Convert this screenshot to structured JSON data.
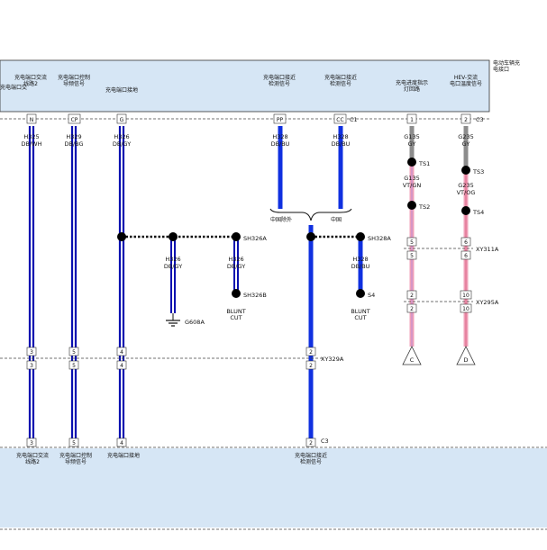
{
  "header": {
    "right_label": "电动车辆充电接口",
    "modules": [
      {
        "id": "m0",
        "label": "充电端口交"
      },
      {
        "id": "m1",
        "label": "充电端口交流线路2"
      },
      {
        "id": "m2",
        "label": "充电端口控制导频信号"
      },
      {
        "id": "m3",
        "label": "充电端口接地"
      },
      {
        "id": "m4",
        "label": "充电端口接近检测信号"
      },
      {
        "id": "m5",
        "label": "充电端口接近检测信号"
      },
      {
        "id": "m6",
        "label": "充电进度指示灯回路"
      },
      {
        "id": "m7",
        "label": "HEV-交流电口温度信号"
      }
    ]
  },
  "top_connector": {
    "c1": "C1",
    "c3": "C3"
  },
  "pins_top": [
    "N",
    "CP",
    "G",
    "PP",
    "CC",
    "1",
    "2"
  ],
  "wires": [
    {
      "id": "w1",
      "circuit": "H325",
      "color": "DB/WH"
    },
    {
      "id": "w2",
      "circuit": "H329",
      "color": "DB/BG"
    },
    {
      "id": "w3",
      "circuit": "H326",
      "color": "DB/GY"
    },
    {
      "id": "w4",
      "circuit": "H328",
      "color": "DB/BU"
    },
    {
      "id": "w5",
      "circuit": "H328",
      "color": "DB/BU"
    },
    {
      "id": "w6a",
      "circuit": "G135",
      "color": "GY"
    },
    {
      "id": "w6b",
      "circuit": "G135",
      "color": "VT/GN"
    },
    {
      "id": "w7a",
      "circuit": "G235",
      "color": "GY"
    },
    {
      "id": "w7b",
      "circuit": "G235",
      "color": "VT/OG"
    },
    {
      "id": "w3b",
      "circuit": "H326",
      "color": "DB/GY"
    },
    {
      "id": "w3c",
      "circuit": "H326",
      "color": "DB/GY"
    },
    {
      "id": "w5b",
      "circuit": "H328",
      "color": "DB/BU"
    }
  ],
  "splices": {
    "sh326a": "SH326A",
    "sh326b": "SH326B",
    "sh328a": "SH328A",
    "s4": "S4",
    "ts1": "TS1",
    "ts2": "TS2",
    "ts3": "TS3",
    "ts4": "TS4"
  },
  "ground": "G608A",
  "blunt_cut": "BLUNT CUT",
  "options": {
    "left": "中国除外",
    "right": "中国"
  },
  "inline_connectors": {
    "xy311a": "XY311A",
    "xy295a": "XY295A",
    "xy329a": "XY329A",
    "c3_bottom": "C3"
  },
  "pins": {
    "xy311a_top": [
      "5",
      "6"
    ],
    "xy311a_bottom": [
      "5",
      "6"
    ],
    "xy295a_top": [
      "2",
      "10"
    ],
    "xy295a_bottom": [
      "2",
      "10"
    ],
    "xy329a_top": [
      "3",
      "5",
      "4",
      "2"
    ],
    "xy329a_bottom": [
      "3",
      "5",
      "4",
      "2"
    ],
    "bottom": [
      "3",
      "5",
      "4",
      "2"
    ]
  },
  "continuation": {
    "c": "C",
    "d": "D"
  },
  "bottom_labels": [
    {
      "id": "b1",
      "label": "充电端口交流线路2"
    },
    {
      "id": "b2",
      "label": "充电端口控制导频信号"
    },
    {
      "id": "b3",
      "label": "充电端口接地"
    },
    {
      "id": "b4",
      "label": "充电端口接近检测信号"
    }
  ],
  "colors": {
    "panel": "#d6e6f5",
    "wire_dark_blue": "#0a10b0",
    "wire_blue": "#1030e0",
    "gray": "#8c8c8c",
    "pink": "#f0a0b8",
    "violet": "#c58fd0"
  }
}
